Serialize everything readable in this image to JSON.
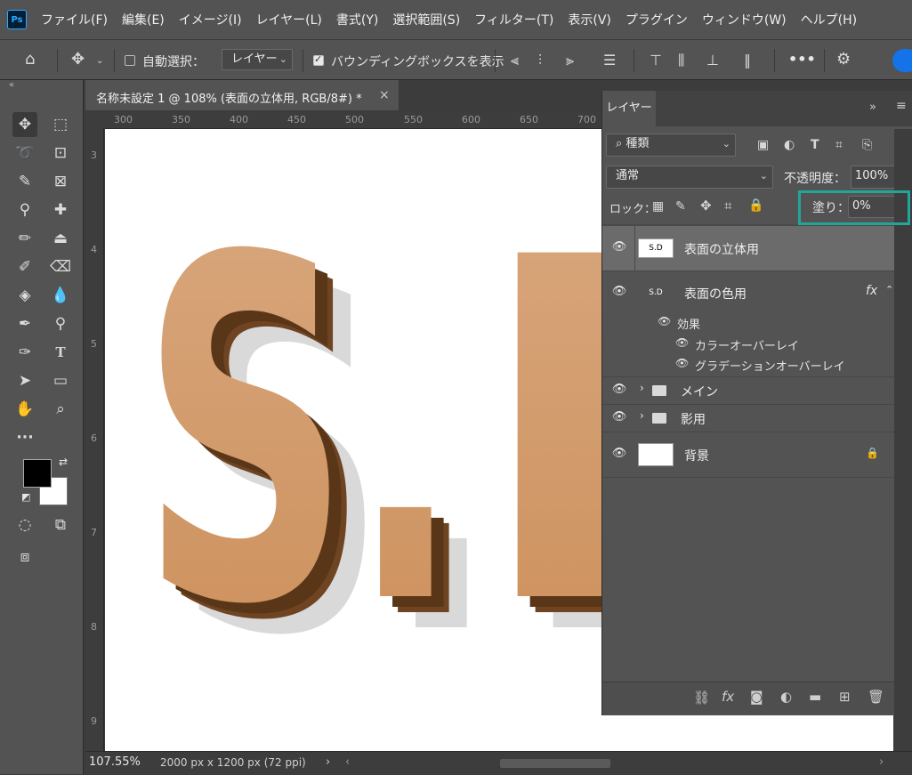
{
  "menu": [
    "ファイル(F)",
    "編集(E)",
    "イメージ(I)",
    "レイヤー(L)",
    "書式(Y)",
    "選択範囲(S)",
    "フィルター(T)",
    "表示(V)",
    "プラグイン",
    "ウィンドウ(W)",
    "ヘルプ(H)"
  ],
  "app_logo": "Ps",
  "options": {
    "auto_select_label": "自動選択：",
    "auto_select_value": "レイヤー",
    "bounding_box_label": "バウンディングボックスを表示",
    "more": "•••"
  },
  "document": {
    "tab_title": "名称未設定 1 @ 108% (表面の立体用, RGB/8#) *",
    "close": "×",
    "ruler_ticks": [
      "300",
      "350",
      "400",
      "450",
      "500",
      "550",
      "600",
      "650",
      "700"
    ],
    "ruler_left_ticks": [
      "3",
      "4",
      "5",
      "6",
      "7",
      "8",
      "9"
    ],
    "canvas_text_left": "S.",
    "canvas_text_right": "D",
    "zoom": "107.55%",
    "doc_info": "2000 px x 1200 px (72 ppi)"
  },
  "layers_panel": {
    "tab": "レイヤー",
    "filter_kind": "種類",
    "blend_mode": "通常",
    "opacity_label": "不透明度：",
    "opacity_value": "100%",
    "lock_label": "ロック：",
    "fill_label": "塗り：",
    "fill_value": "0%",
    "layers": [
      {
        "name": "表面の立体用",
        "type": "text",
        "selected": true
      },
      {
        "name": "表面の色用",
        "type": "text",
        "fx": "fx"
      },
      {
        "name": "効果",
        "type": "effect-group"
      },
      {
        "name": "カラーオーバーレイ",
        "type": "effect"
      },
      {
        "name": "グラデーションオーバーレイ",
        "type": "effect"
      },
      {
        "name": "メイン",
        "type": "group"
      },
      {
        "name": "影用",
        "type": "group"
      },
      {
        "name": "背景",
        "type": "background",
        "locked": true
      }
    ],
    "thumb_text": "S.D"
  },
  "colors": {
    "accent": "#31a8ff",
    "highlight": "#21a79a",
    "letter_face_top": "#d8a57c",
    "letter_face_bottom": "#cf915d",
    "letter_side": "#6e4422",
    "shadow": "#d9d9d9"
  }
}
